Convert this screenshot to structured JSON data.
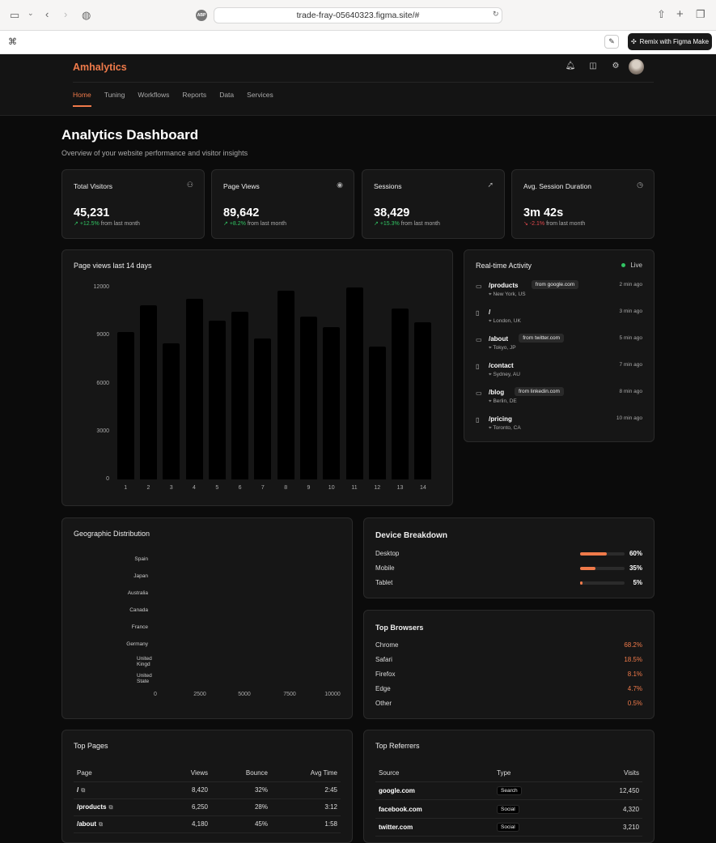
{
  "browser": {
    "url": "trade-fray-05640323.figma.site/#",
    "abp_label": "ABP",
    "remix_label": "Remix with Figma Make"
  },
  "app": {
    "brand": "Amhalytics",
    "nav": [
      "Home",
      "Tuning",
      "Workflows",
      "Reports",
      "Data",
      "Services"
    ],
    "active_nav": "Home"
  },
  "page": {
    "title": "Analytics Dashboard",
    "subtitle": "Overview of your website performance and visitor insights"
  },
  "stats": [
    {
      "title": "Total Visitors",
      "value": "45,231",
      "change": "+12.5%",
      "suffix": "from last month",
      "trend": "up",
      "icon": "users-icon"
    },
    {
      "title": "Page Views",
      "value": "89,642",
      "change": "+8.2%",
      "suffix": "from last month",
      "trend": "up",
      "icon": "eye-icon"
    },
    {
      "title": "Sessions",
      "value": "38,429",
      "change": "+15.3%",
      "suffix": "from last month",
      "trend": "up",
      "icon": "cursor-icon"
    },
    {
      "title": "Avg. Session Duration",
      "value": "3m 42s",
      "change": "-2.1%",
      "suffix": "from last month",
      "trend": "down",
      "icon": "clock-icon"
    }
  ],
  "pageviews_chart": {
    "title": "Page views last 14 days"
  },
  "chart_data": {
    "type": "bar",
    "title": "Page views last 14 days",
    "categories": [
      "1",
      "2",
      "3",
      "4",
      "5",
      "6",
      "7",
      "8",
      "9",
      "10",
      "11",
      "12",
      "13",
      "14"
    ],
    "values": [
      9200,
      10900,
      8500,
      11300,
      9900,
      10500,
      8800,
      11800,
      10200,
      9500,
      12000,
      8300,
      10700,
      9800
    ],
    "yticks": [
      "0",
      "3000",
      "6000",
      "9000",
      "12000"
    ],
    "ylim": [
      0,
      12000
    ],
    "bar_color": "#000000"
  },
  "realtime": {
    "title": "Real-time Activity",
    "live_label": "Live",
    "items": [
      {
        "path": "/products",
        "source": "from google.com",
        "location": "New York, US",
        "time": "2 min ago",
        "device": "desktop"
      },
      {
        "path": "/",
        "source": "",
        "location": "London, UK",
        "time": "3 min ago",
        "device": "mobile"
      },
      {
        "path": "/about",
        "source": "from twitter.com",
        "location": "Tokyo, JP",
        "time": "5 min ago",
        "device": "desktop"
      },
      {
        "path": "/contact",
        "source": "",
        "location": "Sydney, AU",
        "time": "7 min ago",
        "device": "mobile"
      },
      {
        "path": "/blog",
        "source": "from linkedin.com",
        "location": "Berlin, DE",
        "time": "8 min ago",
        "device": "desktop"
      },
      {
        "path": "/pricing",
        "source": "",
        "location": "Toronto, CA",
        "time": "10 min ago",
        "device": "mobile"
      }
    ]
  },
  "geo": {
    "title": "Geographic Distribution",
    "countries": [
      "Spain",
      "Japan",
      "Australia",
      "Canada",
      "France",
      "Germany",
      "United Kingd",
      "United State"
    ],
    "xticks": [
      "0",
      "2500",
      "5000",
      "7500",
      "10000"
    ]
  },
  "device": {
    "title": "Device Breakdown",
    "rows": [
      {
        "label": "Desktop",
        "pct": "60%",
        "value": 60
      },
      {
        "label": "Mobile",
        "pct": "35%",
        "value": 35
      },
      {
        "label": "Tablet",
        "pct": "5%",
        "value": 5
      }
    ]
  },
  "browsers": {
    "title": "Top Browsers",
    "rows": [
      {
        "label": "Chrome",
        "pct": "68.2%"
      },
      {
        "label": "Safari",
        "pct": "18.5%"
      },
      {
        "label": "Firefox",
        "pct": "8.1%"
      },
      {
        "label": "Edge",
        "pct": "4.7%"
      },
      {
        "label": "Other",
        "pct": "0.5%"
      }
    ]
  },
  "top_pages": {
    "title": "Top Pages",
    "headers": [
      "Page",
      "Views",
      "Bounce",
      "Avg Time"
    ],
    "rows": [
      {
        "page": "/",
        "views": "8,420",
        "bounce": "32%",
        "time": "2:45"
      },
      {
        "page": "/products",
        "views": "6,250",
        "bounce": "28%",
        "time": "3:12"
      },
      {
        "page": "/about",
        "views": "4,180",
        "bounce": "45%",
        "time": "1:58"
      }
    ]
  },
  "top_referrers": {
    "title": "Top Referrers",
    "headers": [
      "Source",
      "Type",
      "Visits"
    ],
    "rows": [
      {
        "source": "google.com",
        "type": "Search",
        "visits": "12,450"
      },
      {
        "source": "facebook.com",
        "type": "Social",
        "visits": "4,320"
      },
      {
        "source": "twitter.com",
        "type": "Social",
        "visits": "3,210"
      }
    ]
  },
  "colors": {
    "accent": "#ef7a4a",
    "positive": "#31c463",
    "negative": "#e5484d",
    "card": "#161616",
    "background": "#0b0b0b"
  }
}
